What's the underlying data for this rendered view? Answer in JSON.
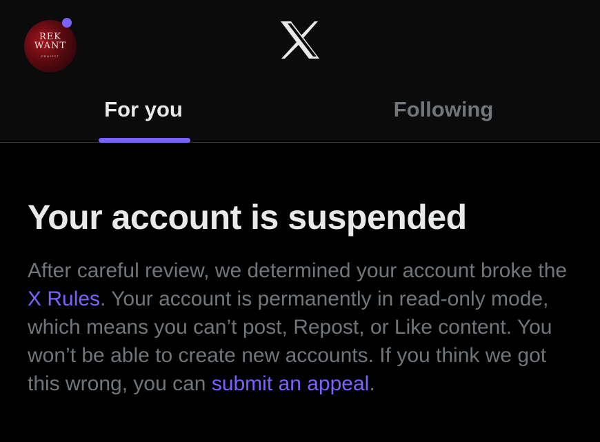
{
  "header": {
    "avatar_text_line1": "REK",
    "avatar_text_line2": "WANT",
    "avatar_text_small": "PROJECT",
    "logo_icon": "x-logo-icon",
    "notification_dot_color": "#7b61ff"
  },
  "tabs": [
    {
      "label": "For you",
      "active": true
    },
    {
      "label": "Following",
      "active": false
    }
  ],
  "colors": {
    "accent": "#7b61ff",
    "background": "#000000",
    "text_primary": "#e7e9ea",
    "text_secondary": "#71767b"
  },
  "notice": {
    "title": "Your account is suspended",
    "text_1": "After careful review, we determined your account broke the ",
    "link_rules": "X Rules",
    "text_2": ". Your account is permanently in read-only mode, which means you can’t post, Repost, or Like content. You won’t be able to create new accounts. If you think we got this wrong, you can ",
    "link_appeal": "submit an appeal",
    "text_3": "."
  }
}
